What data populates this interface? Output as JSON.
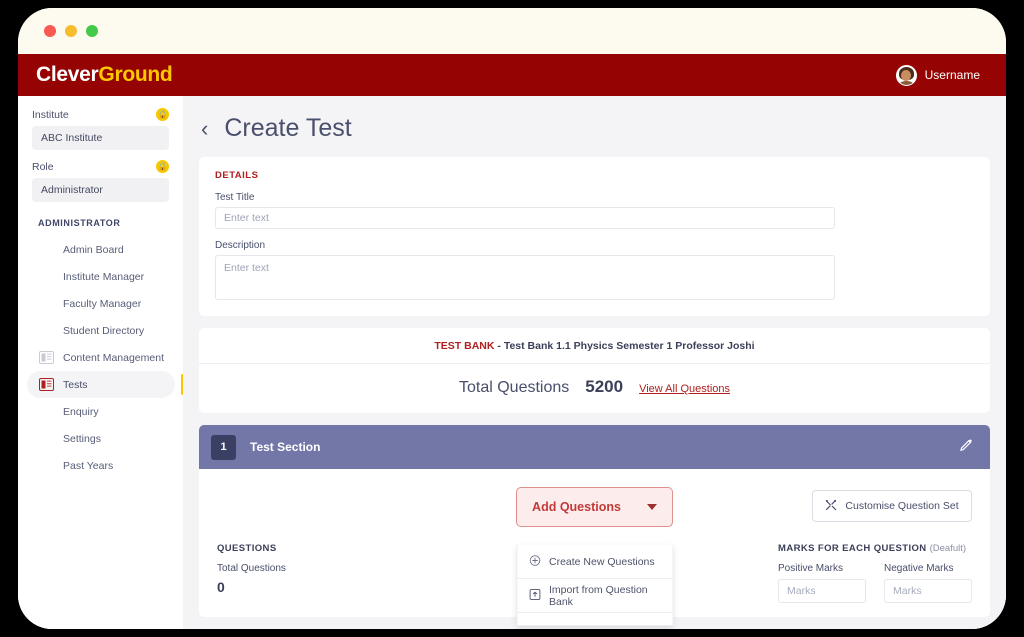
{
  "window": {
    "traffic_lights": [
      "close",
      "minimize",
      "maximize"
    ]
  },
  "brandbar": {
    "logo_first": "Clever",
    "logo_second": "Ground",
    "username": "Username",
    "bg_color": "#960303",
    "accent_color": "#ffc700"
  },
  "sidebar": {
    "institute": {
      "label": "Institute",
      "value": "ABC Institute",
      "badge": "lock"
    },
    "role": {
      "label": "Role",
      "value": "Administrator",
      "badge": "lock"
    },
    "section_title": "ADMINISTRATOR",
    "items": [
      {
        "label": "Admin Board",
        "icon": "none",
        "active": false
      },
      {
        "label": "Institute Manager",
        "icon": "none",
        "active": false
      },
      {
        "label": "Faculty Manager",
        "icon": "none",
        "active": false
      },
      {
        "label": "Student Directory",
        "icon": "none",
        "active": false
      },
      {
        "label": "Content Management",
        "icon": "document-grey",
        "active": false
      },
      {
        "label": "Tests",
        "icon": "document-red",
        "active": true
      },
      {
        "label": "Enquiry",
        "icon": "none",
        "active": false
      },
      {
        "label": "Settings",
        "icon": "none",
        "active": false
      },
      {
        "label": "Past Years",
        "icon": "none",
        "active": false
      }
    ],
    "active_indicator_color": "#ffc300"
  },
  "page": {
    "back_label": "‹",
    "title": "Create Test"
  },
  "details": {
    "heading": "DETAILS",
    "heading_color": "#b01e1e",
    "test_title_label": "Test Title",
    "test_title_value": "",
    "test_title_placeholder": "Enter text",
    "description_label": "Description",
    "description_value": "",
    "description_placeholder": "Enter text"
  },
  "test_bank": {
    "tag": "TEST BANK",
    "separator": " - ",
    "meta": "Test Bank 1.1 Physics  Semester 1  Professor Joshi",
    "total_questions_label": "Total Questions",
    "total_questions_value": "5200",
    "view_all_link": "View All Questions"
  },
  "section": {
    "number": "1",
    "title": "Test Section",
    "edit_icon": "pencil-icon",
    "bar_color": "#7377a8",
    "number_bg": "#3b3f63"
  },
  "actions": {
    "add_questions_label": "Add Questions",
    "customise_label": "Customise Question Set",
    "customise_icon": "tools-icon",
    "dropdown": {
      "open": true,
      "items": [
        {
          "label": "Create New Questions",
          "icon": "plus-circle-icon"
        },
        {
          "label": "Import from Question Bank",
          "icon": "import-box-icon"
        },
        {
          "label": "",
          "icon": ""
        }
      ]
    }
  },
  "questions_stats": {
    "heading": "QUESTIONS",
    "total_label": "Total Questions",
    "total_value": "0"
  },
  "marks": {
    "heading": "MARKS FOR EACH QUESTION",
    "heading_suffix": "(Deafult)",
    "positive_label": "Positive Marks",
    "positive_value": "",
    "positive_placeholder": "Marks",
    "negative_label": "Negative Marks",
    "negative_value": "",
    "negative_placeholder": "Marks"
  }
}
